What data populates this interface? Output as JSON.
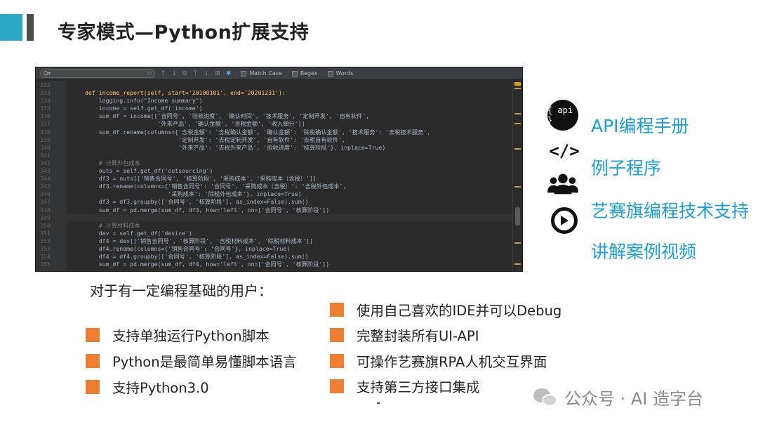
{
  "title": "专家模式—Python扩展支持",
  "editor": {
    "toolbar": {
      "search_glyph": "Q▾",
      "match_case": "Match Case",
      "regex": "Regex",
      "words": "Words"
    },
    "lines": [
      {
        "num": "332",
        "code": ""
      },
      {
        "num": "333",
        "code": "def income_report(self, start='20100101', end='20201231'):"
      },
      {
        "num": "334",
        "code": "    logging.info(\"Income summary\")"
      },
      {
        "num": "335",
        "code": "    income = self.get_df('income')"
      },
      {
        "num": "336",
        "code": "    sum_df = income[['合同号', '验收进度', '确认时间', '技术服务', '定制开发', '自有软件',"
      },
      {
        "num": "337",
        "code": "                     '外来产品', '确认金额', '含税金额', '收入细分']]"
      },
      {
        "num": "338",
        "code": "    sum_df.rename(columns={'含税金额': '含税确认金额', '确认金额': '除税确认金额', '技术服务': '去税技术服务',"
      },
      {
        "num": "339",
        "code": "                           '定制开发': '去税定制开发', '自有软件': '去税自有软件',"
      },
      {
        "num": "340",
        "code": "                           '外来产品': '去税外来产品', '验收进度': '核算阶段'}, inplace=True)"
      },
      {
        "num": "341",
        "code": ""
      },
      {
        "num": "342",
        "code": "    # 计算外包成本"
      },
      {
        "num": "343",
        "code": "    outs = self.get_df('outsourcing')"
      },
      {
        "num": "344",
        "code": "    df3 = outs[['销售合同号', '核算阶段', '采购成本', '采购成本（含税）']]"
      },
      {
        "num": "345",
        "code": "    df3.rename(columns={'销售合同号': '合同号', '采购成本（含税）': '含税外包成本',"
      },
      {
        "num": "346",
        "code": "                        '采购成本': '除税外包成本'}, inplace=True)"
      },
      {
        "num": "347",
        "code": "    df3 = df3.groupby(['合同号', '核算阶段'], as_index=False).sum()"
      },
      {
        "num": "348",
        "code": "    sum_df = pd.merge(sum_df, df3, how='left', on=['合同号', '核算阶段'])"
      },
      {
        "num": "349",
        "code": ""
      },
      {
        "num": "350",
        "code": "    # 计算材料成本"
      },
      {
        "num": "351",
        "code": "    dev = self.get_df('device')"
      },
      {
        "num": "352",
        "code": "    df4 = dev[['销售合同号', '核算阶段', '含税材料成本', '除税材料成本']]"
      },
      {
        "num": "353",
        "code": "    df4.rename(columns={'销售合同号': '合同号'}, inplace=True)"
      },
      {
        "num": "354",
        "code": "    df4 = df4.groupby(['合同号', '核算阶段'], as_index=False).sum()"
      },
      {
        "num": "355",
        "code": "    sum_df = pd.merge(sum_df, df4, how='left', on=['合同号', '核算阶段'])"
      }
    ]
  },
  "links": [
    {
      "label": "API编程手册",
      "icon": "api-icon",
      "icon_text": "{ api }"
    },
    {
      "label": "例子程序",
      "icon": "code-icon",
      "icon_text": "</>"
    },
    {
      "label": "艺赛旗编程技术支持",
      "icon": "users-icon",
      "icon_text": ""
    },
    {
      "label": "讲解案例视频",
      "icon": "play-icon",
      "icon_text": ""
    }
  ],
  "subheading": "对于有一定编程基础的用户：",
  "bullets_left": [
    "支持单独运行Python脚本",
    "Python是最简单易懂脚本语言",
    "支持Python3.0"
  ],
  "bullets_right": [
    "使用自己喜欢的IDE并可以Debug",
    "完整封装所有UI-API",
    "可操作艺赛旗RPA人机交互界面",
    "支持第三方接口集成"
  ],
  "watermark": "公众号 · AI 造字台",
  "colors": {
    "accent": "#2aa9c4",
    "link": "#1a9fd6",
    "bullet": "#ed7d31"
  }
}
